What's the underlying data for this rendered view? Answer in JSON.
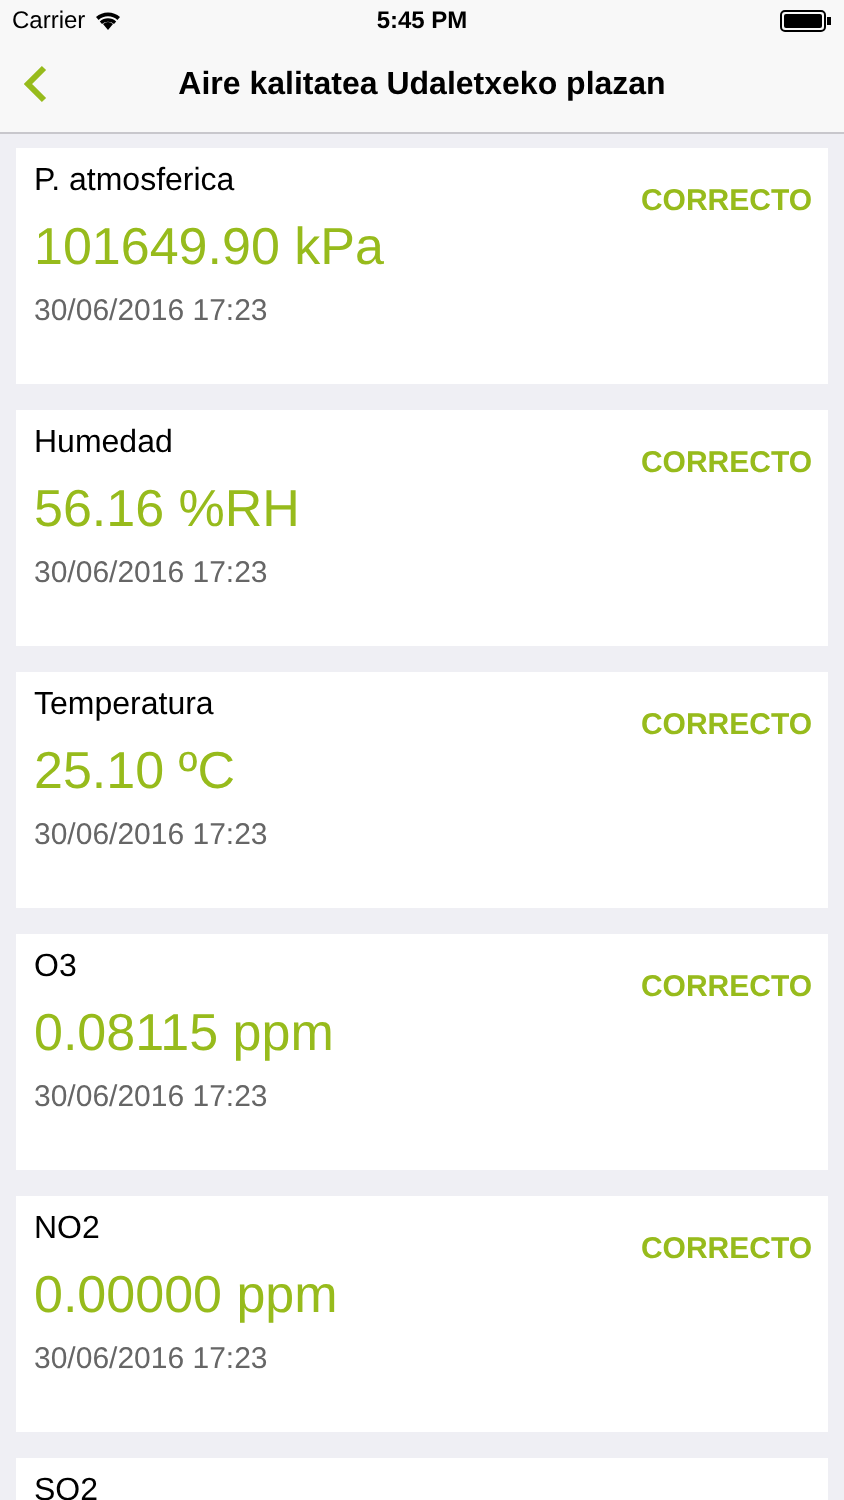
{
  "status_bar": {
    "carrier": "Carrier",
    "time": "5:45 PM"
  },
  "nav": {
    "title": "Aire kalitatea Udaletxeko plazan"
  },
  "readings": [
    {
      "label": "P. atmosferica",
      "status": "CORRECTO",
      "value": "101649.90 kPa",
      "date": "30/06/2016 17:23"
    },
    {
      "label": "Humedad",
      "status": "CORRECTO",
      "value": "56.16 %RH",
      "date": "30/06/2016 17:23"
    },
    {
      "label": "Temperatura",
      "status": "CORRECTO",
      "value": "25.10 ºC",
      "date": "30/06/2016 17:23"
    },
    {
      "label": "O3",
      "status": "CORRECTO",
      "value": "0.08115 ppm",
      "date": "30/06/2016 17:23"
    },
    {
      "label": "NO2",
      "status": "CORRECTO",
      "value": "0.00000 ppm",
      "date": "30/06/2016 17:23"
    },
    {
      "label": "SO2"
    }
  ]
}
